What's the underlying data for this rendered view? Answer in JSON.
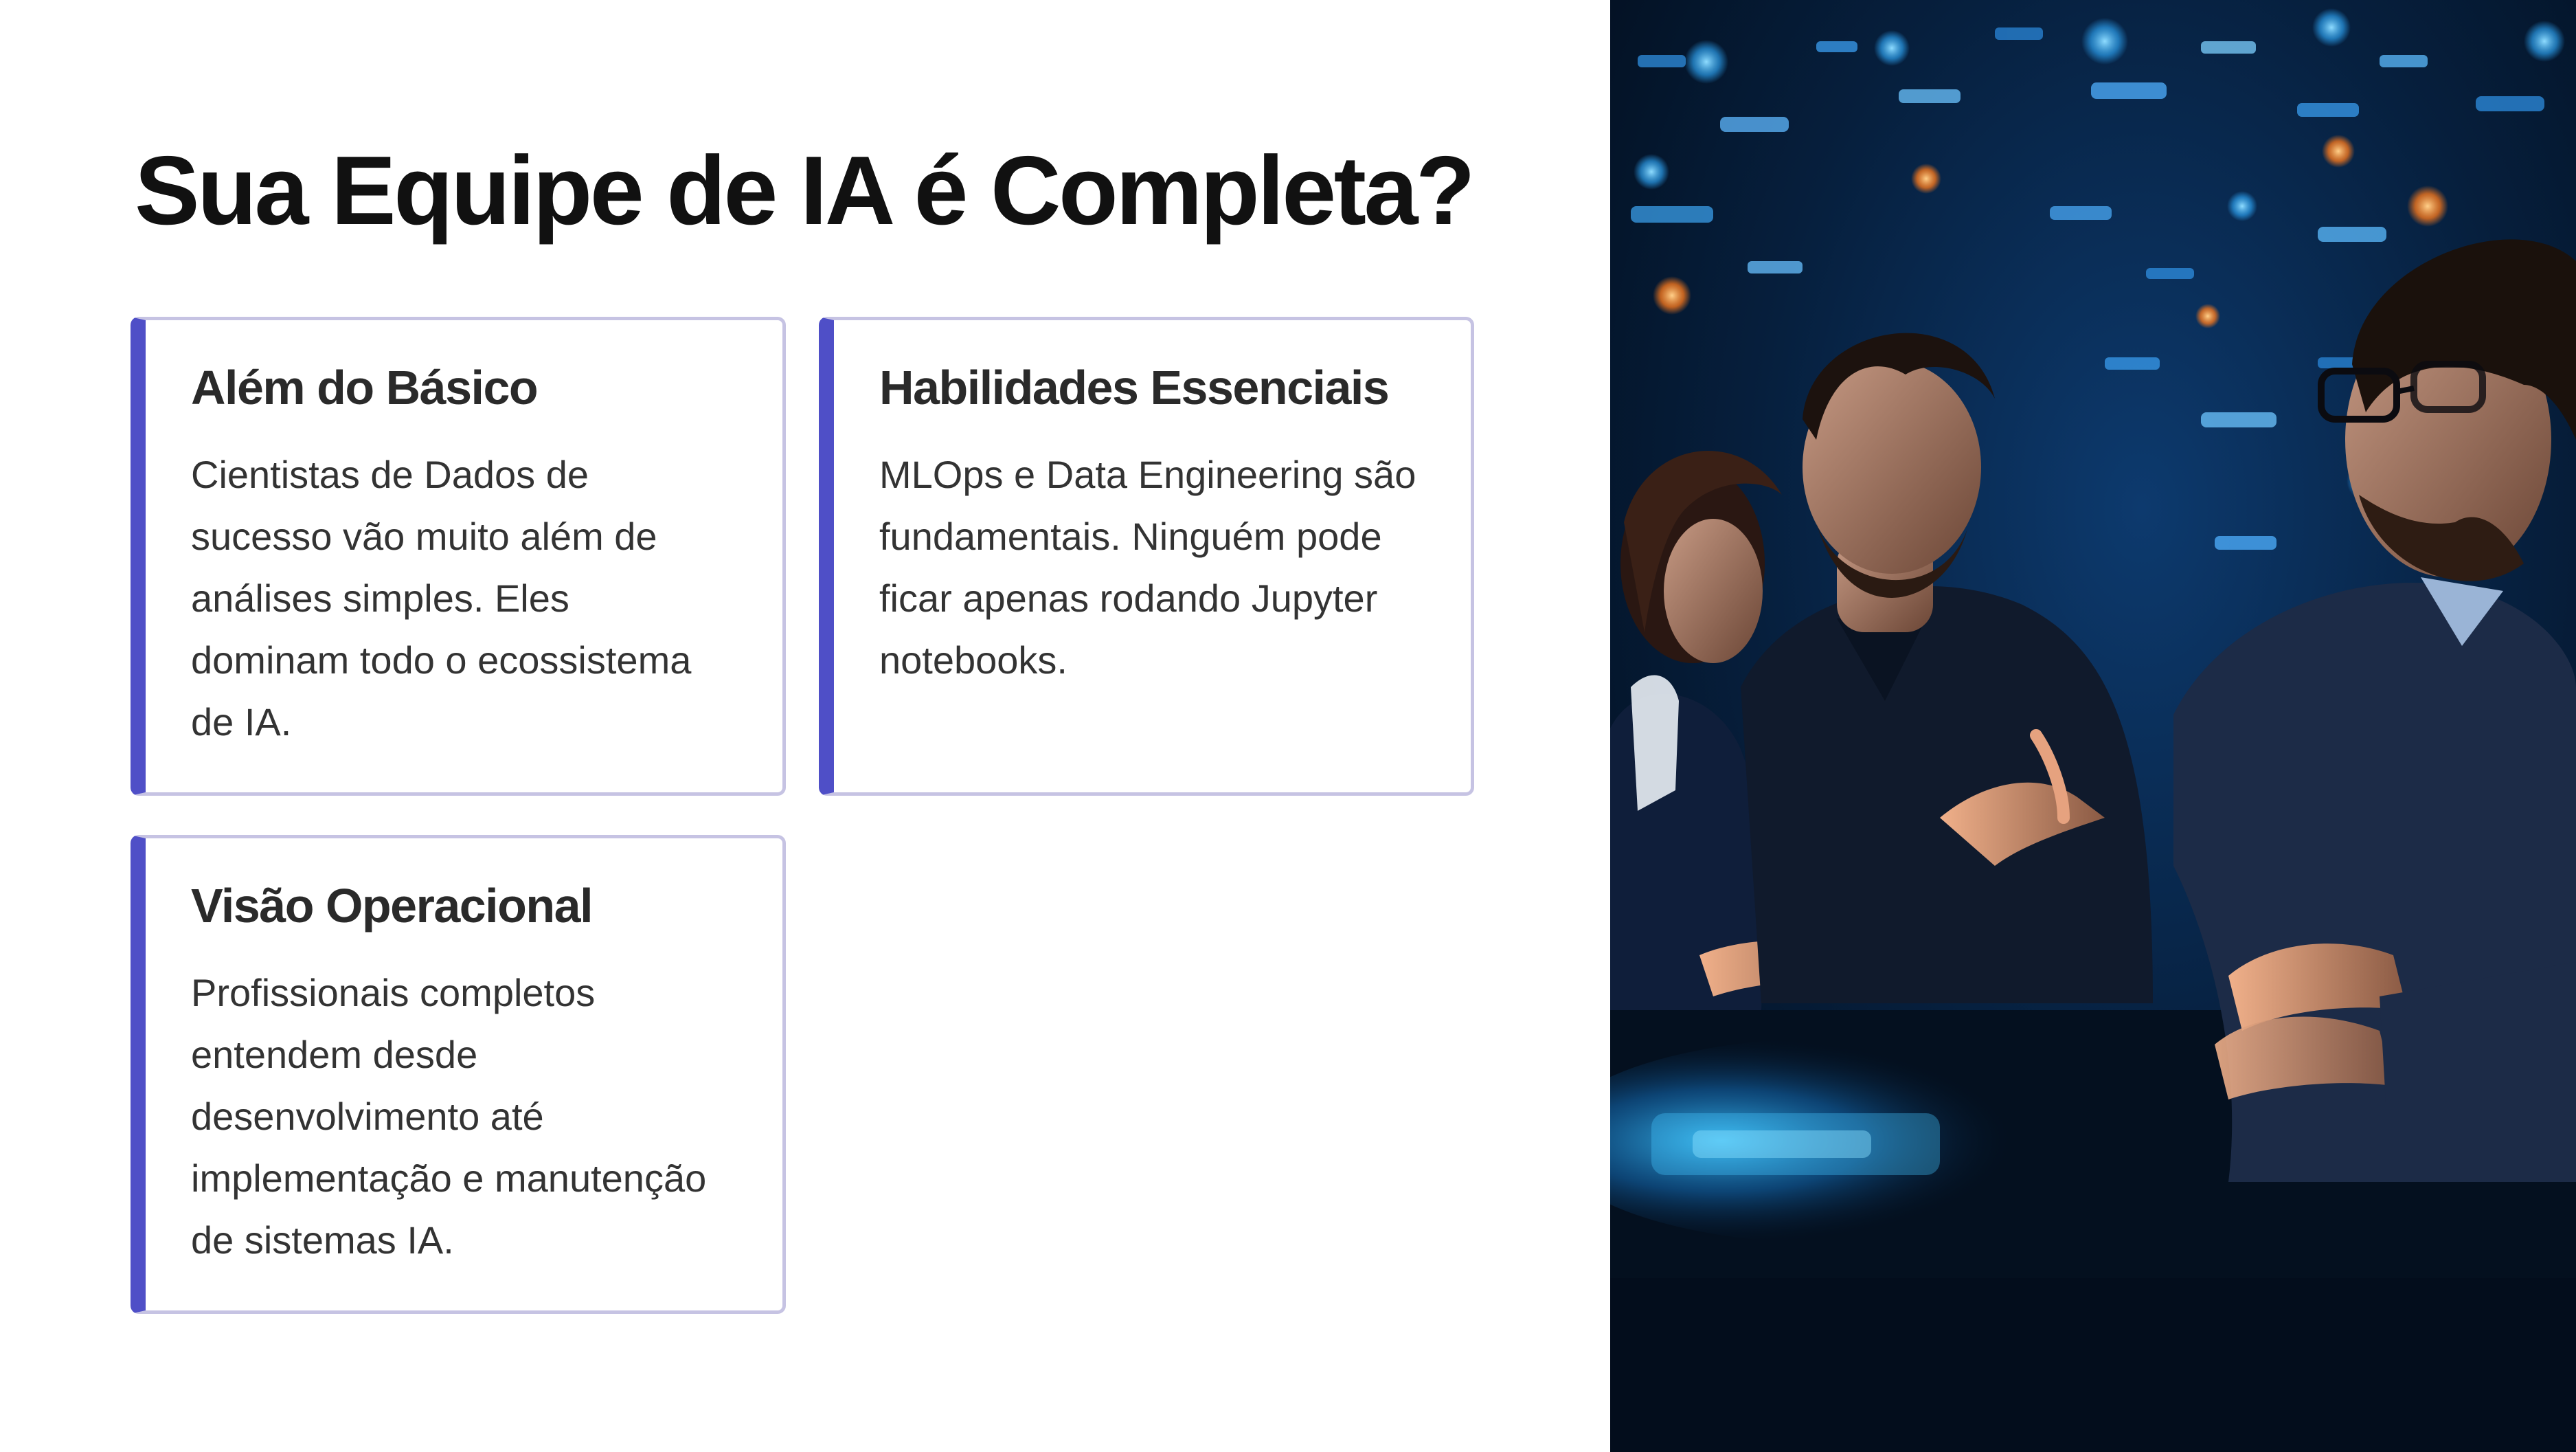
{
  "title": "Sua Equipe de IA é Completa?",
  "cards": [
    {
      "heading": "Além do Básico",
      "lines": [
        "Cientistas de Dados de",
        "sucesso vão muito além de",
        "análises simples. Eles",
        "dominam todo o ecossistema",
        "de IA."
      ]
    },
    {
      "heading": "Habilidades Essenciais",
      "lines": [
        "MLOps e Data Engineering são",
        "fundamentais. Ninguém pode",
        "ficar apenas rodando Jupyter",
        "notebooks."
      ]
    },
    {
      "heading": "Visão Operacional",
      "lines": [
        "Profissionais completos",
        "entendem desde",
        "desenvolvimento até",
        "implementação e manutenção",
        "de sistemas IA."
      ]
    }
  ],
  "colors": {
    "accent": "#4f4fc7",
    "card_border": "#c6c3e3",
    "title": "#111111",
    "photo_blue": "#1e90ff",
    "photo_orange": "#ff8a2a"
  },
  "image": {
    "icon": "photo-team-ai-lab"
  }
}
